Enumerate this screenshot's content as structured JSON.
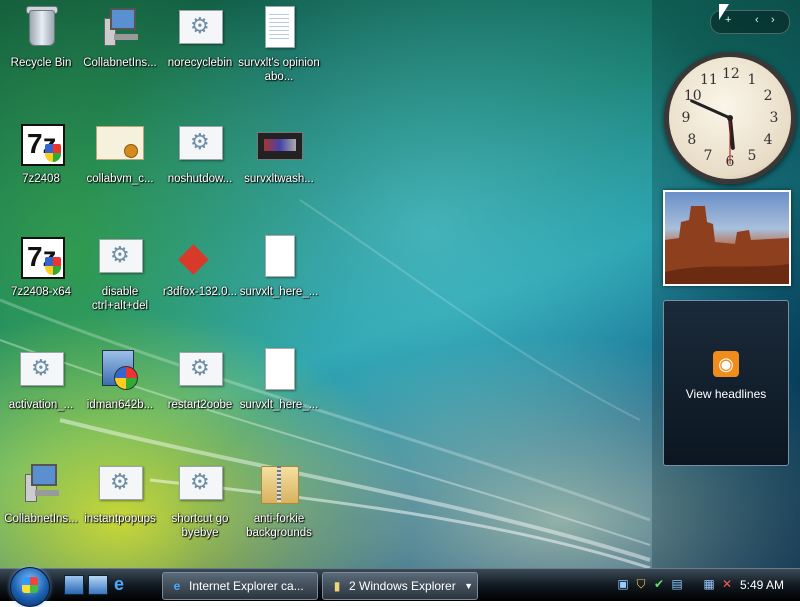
{
  "desktop": {
    "icons": [
      {
        "label": "Recycle Bin",
        "icon": "recycle-bin-icon"
      },
      {
        "label": "CollabnetIns...",
        "icon": "network-computer-icon"
      },
      {
        "label": "norecyclebin",
        "icon": "script-gear-icon"
      },
      {
        "label": "survxlt's opinion abo...",
        "icon": "text-document-icon"
      },
      {
        "label": "7z2408",
        "icon": "7zip-installer-icon"
      },
      {
        "label": "collabvm_c...",
        "icon": "certificate-icon"
      },
      {
        "label": "noshutdow...",
        "icon": "script-gear-icon"
      },
      {
        "label": "survxltwash...",
        "icon": "screenshot-image-icon"
      },
      {
        "label": "7z2408-x64",
        "icon": "7zip-installer-icon"
      },
      {
        "label": "disable ctrl+alt+del",
        "icon": "script-gear-icon"
      },
      {
        "label": "r3dfox-132.0...",
        "icon": "red-fox-icon"
      },
      {
        "label": "survxlt_here_...",
        "icon": "blank-file-icon"
      },
      {
        "label": "activation_...",
        "icon": "script-gear-icon"
      },
      {
        "label": "idman642b...",
        "icon": "setup-installer-icon"
      },
      {
        "label": "restart2oobe",
        "icon": "script-gear-icon"
      },
      {
        "label": "survxlt_here_...",
        "icon": "blank-file-icon"
      },
      {
        "label": "CollabnetIns...",
        "icon": "network-computer-icon"
      },
      {
        "label": "instantpopups",
        "icon": "script-gear-icon"
      },
      {
        "label": "shortcut go byebye",
        "icon": "script-gear-icon"
      },
      {
        "label": "anti-forkie backgrounds",
        "icon": "zip-folder-icon"
      }
    ]
  },
  "sidebar": {
    "nav_prev": "‹",
    "nav_next": "›",
    "clock": {
      "numerals": [
        "12",
        "1",
        "2",
        "3",
        "4",
        "5",
        "6",
        "7",
        "8",
        "9",
        "10",
        "11"
      ],
      "hour": 5,
      "minute": 49,
      "second": 30
    },
    "feed": {
      "label": "View headlines",
      "icon": "rss-icon"
    }
  },
  "taskbar": {
    "start": "start-orb",
    "quick_launch": [
      "show-desktop-icon",
      "switch-windows-icon",
      "internet-explorer-icon"
    ],
    "tasks": [
      {
        "label": "Internet Explorer ca...",
        "icon": "internet-explorer-icon"
      },
      {
        "label": "2 Windows Explorer",
        "icon": "folder-icon"
      }
    ],
    "tray": {
      "icons": [
        "network-icon",
        "shield-warning-icon",
        "security-check-icon",
        "windows-update-icon",
        "network-connection-icon",
        "speaker-muted-icon"
      ],
      "time": "5:49 AM"
    }
  }
}
